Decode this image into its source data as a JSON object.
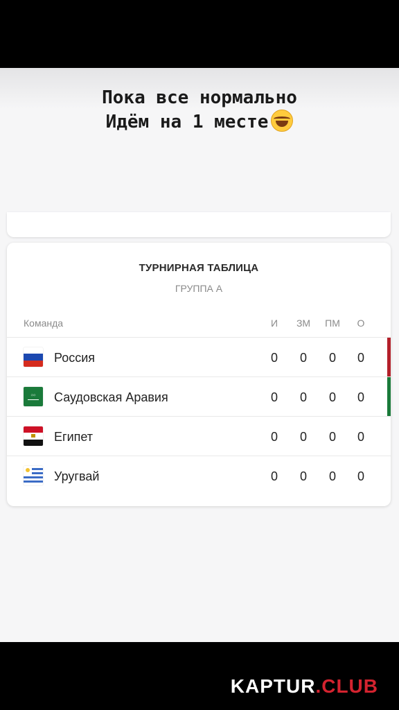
{
  "caption": {
    "line1": "Пока все нормально",
    "line2": "Идём на 1 месте"
  },
  "card": {
    "title": "ТУРНИРНАЯ ТАБЛИЦА",
    "subtitle": "ГРУППА А"
  },
  "table": {
    "headers": {
      "team": "Команда",
      "played": "И",
      "scored": "ЗМ",
      "conceded": "ПМ",
      "points": "О"
    },
    "rows": [
      {
        "team": "Россия",
        "flag": "russia-flag-icon",
        "played": "0",
        "scored": "0",
        "conceded": "0",
        "points": "0",
        "marker_color": "#b3202a"
      },
      {
        "team": "Саудовская Аравия",
        "flag": "saudi-arabia-flag-icon",
        "played": "0",
        "scored": "0",
        "conceded": "0",
        "points": "0",
        "marker_color": "#1a7a3a"
      },
      {
        "team": "Египет",
        "flag": "egypt-flag-icon",
        "played": "0",
        "scored": "0",
        "conceded": "0",
        "points": "0"
      },
      {
        "team": "Уругвай",
        "flag": "uruguay-flag-icon",
        "played": "0",
        "scored": "0",
        "conceded": "0",
        "points": "0"
      }
    ]
  },
  "watermark": {
    "part1": "KAPTUR",
    "part2": ".CLUB"
  },
  "colors": {
    "qualify_marker_1": "#b3202a",
    "qualify_marker_2": "#1a7a3a",
    "watermark_accent": "#d4232f"
  }
}
